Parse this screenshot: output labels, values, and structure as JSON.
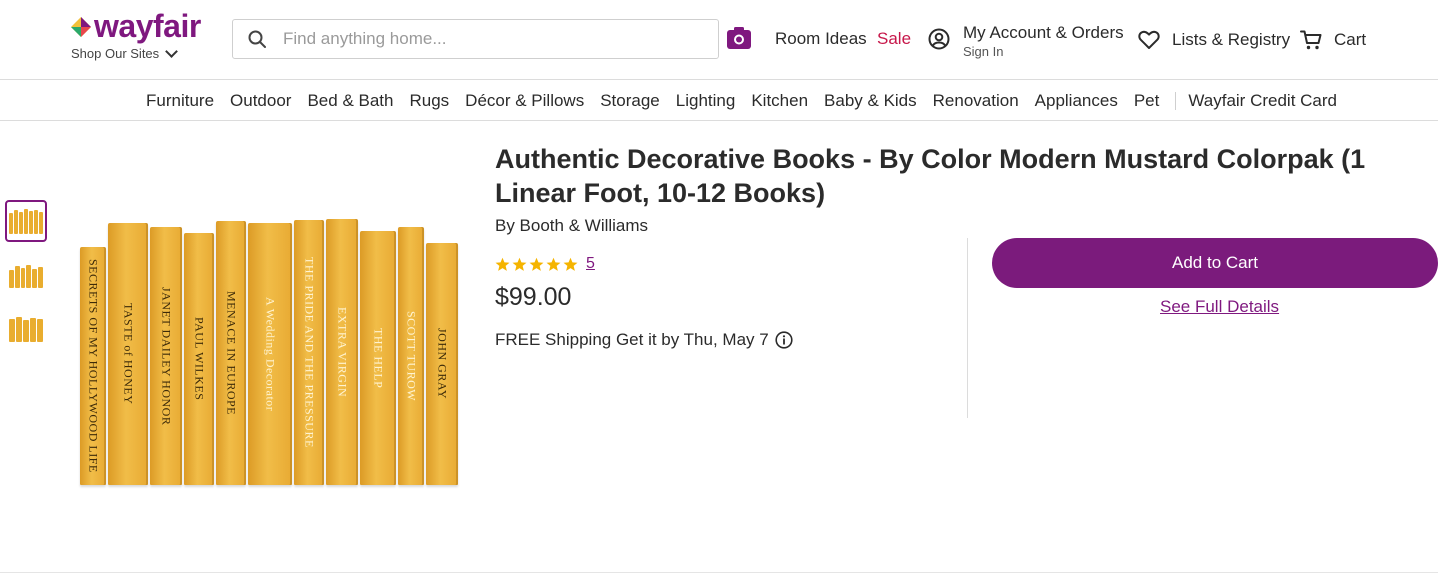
{
  "header": {
    "logo_text": "wayfair",
    "shop_sites_label": "Shop Our Sites",
    "search_placeholder": "Find anything home...",
    "room_ideas": "Room Ideas",
    "sale": "Sale",
    "account_title": "My Account & Orders",
    "account_sub": "Sign In",
    "lists": "Lists & Registry",
    "cart": "Cart",
    "brand_color": "#7f187f",
    "sale_color": "#c7174a"
  },
  "categories": [
    "Furniture",
    "Outdoor",
    "Bed & Bath",
    "Rugs",
    "Décor & Pillows",
    "Storage",
    "Lighting",
    "Kitchen",
    "Baby & Kids",
    "Renovation",
    "Appliances",
    "Pet"
  ],
  "category_extra": "Wayfair Credit Card",
  "product": {
    "title": "Authentic Decorative Books - By Color Modern Mustard Colorpak (1 Linear Foot, 10-12 Books)",
    "brand": "By Booth & Williams",
    "rating_count": "5",
    "rating_stars": 5,
    "price": "$99.00",
    "shipping": "FREE Shipping Get it by Thu, May 7",
    "add_to_cart": "Add to Cart",
    "see_full_details": "See Full Details",
    "book_color": "#e9ad2f"
  },
  "book_spines": [
    "SECRETS OF MY HOLLYWOOD LIFE",
    "TASTE of HONEY",
    "JANET DAILEY HONOR",
    "PAUL WILKES",
    "MENACE IN EUROPE",
    "A Wedding Decorator",
    "THE PRIDE AND THE PRESSURE",
    "EXTRA VIRGIN",
    "THE HELP",
    "SCOTT TUROW",
    "JOHN GRAY"
  ],
  "thumbnails": [
    "thumbnail-1",
    "thumbnail-2",
    "thumbnail-3"
  ]
}
